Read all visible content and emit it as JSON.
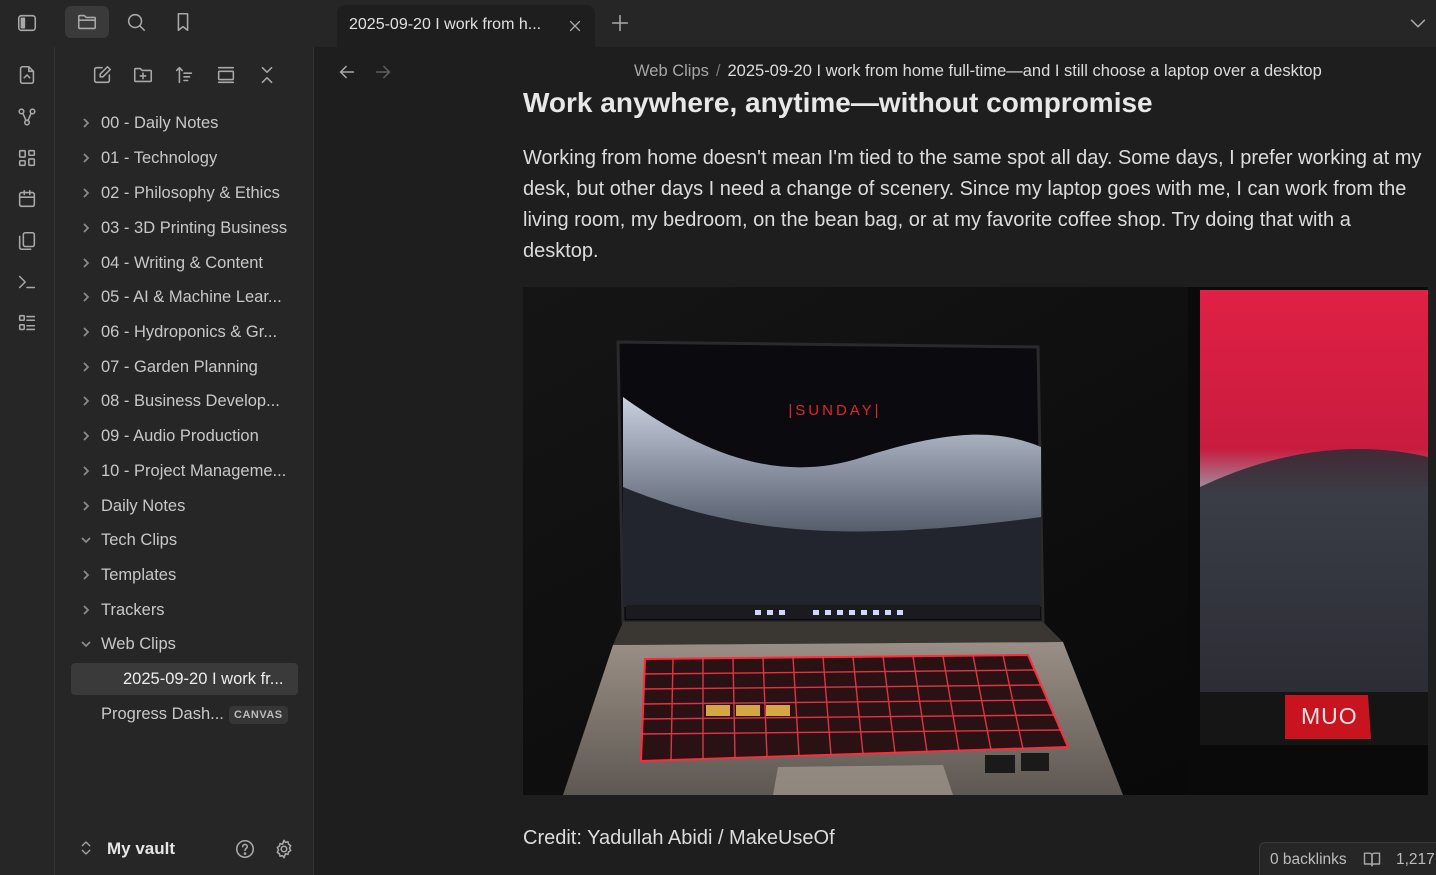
{
  "titlebar": {
    "tab_title": "2025-09-20 I work from h...",
    "icons": [
      "sidebar-toggle-icon",
      "folder-icon",
      "search-icon",
      "bookmark-icon",
      "close-icon",
      "plus-icon",
      "chevron-down-icon"
    ]
  },
  "ribbon": {
    "icons": [
      "open-quick-switcher-icon",
      "graph-view-icon",
      "canvas-icon",
      "daily-note-icon",
      "templates-icon",
      "command-palette-icon",
      "outline-icon"
    ]
  },
  "sidebar": {
    "toolbar_icons": [
      "new-note-icon",
      "new-folder-icon",
      "sort-icon",
      "collapse-view-icon",
      "collapse-all-icon"
    ],
    "items": [
      {
        "label": "00 - Daily Notes",
        "expanded": false
      },
      {
        "label": "01 - Technology",
        "expanded": false
      },
      {
        "label": "02 - Philosophy & Ethics",
        "expanded": false
      },
      {
        "label": "03 - 3D Printing Business",
        "expanded": false
      },
      {
        "label": "04 - Writing & Content",
        "expanded": false
      },
      {
        "label": "05 - AI & Machine Lear...",
        "expanded": false
      },
      {
        "label": "06 - Hydroponics & Gr...",
        "expanded": false
      },
      {
        "label": "07 - Garden Planning",
        "expanded": false
      },
      {
        "label": "08 - Business Develop...",
        "expanded": false
      },
      {
        "label": "09 - Audio Production",
        "expanded": false
      },
      {
        "label": "10 - Project Manageme...",
        "expanded": false
      },
      {
        "label": "Daily Notes",
        "expanded": false
      },
      {
        "label": "Tech Clips",
        "expanded": true
      },
      {
        "label": "Templates",
        "expanded": false
      },
      {
        "label": "Trackers",
        "expanded": false
      },
      {
        "label": "Web Clips",
        "expanded": true
      }
    ],
    "active_file": "2025-09-20 I work fr...",
    "canvas_file": "Progress Dash...",
    "canvas_badge": "CANVAS",
    "vault_name": "My vault"
  },
  "main": {
    "breadcrumb": {
      "folder": "Web Clips",
      "separator": "/",
      "file": "2025-09-20 I work from home full-time—and I still choose a laptop over a desktop"
    },
    "heading": "Work anywhere, anytime—without compromise",
    "paragraph": "Working from home doesn't mean I'm tied to the same spot all day. Some days, I prefer working at my desk, but other days I need a change of scenery. Since my laptop goes with me, I can work from the living room, my bedroom, on the bean bag, or at my favorite coffee shop. Try doing that with a desktop.",
    "image": {
      "screen_text": "|SUNDAY|",
      "watermark": "MUO"
    },
    "caption": "Credit: Yadullah Abidi / MakeUseOf"
  },
  "status": {
    "backlinks": "0 backlinks",
    "count": "1,217"
  },
  "colors": {
    "bg": "#1e1e1e",
    "panel": "#262626",
    "keyboard_glow": "#ff2a3a"
  }
}
